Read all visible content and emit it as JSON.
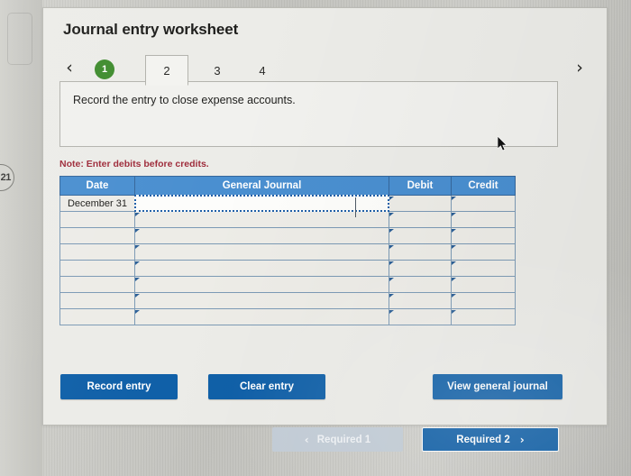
{
  "edge_badge": {
    "label": "21"
  },
  "page": {
    "title": "Journal entry worksheet"
  },
  "tabs": {
    "prev_icon": "‹",
    "next_icon": "›",
    "items": [
      {
        "label": "1",
        "state": "completed"
      },
      {
        "label": "2",
        "state": "active"
      },
      {
        "label": "3",
        "state": "inactive"
      },
      {
        "label": "4",
        "state": "inactive"
      }
    ]
  },
  "instruction": {
    "text": "Record the entry to close expense accounts."
  },
  "note": {
    "text": "Note: Enter debits before credits."
  },
  "table": {
    "headers": {
      "date": "Date",
      "general_journal": "General Journal",
      "debit": "Debit",
      "credit": "Credit"
    },
    "rows": [
      {
        "date": "December 31",
        "general_journal": "",
        "debit": "",
        "credit": "",
        "selected": true
      },
      {
        "date": "",
        "general_journal": "",
        "debit": "",
        "credit": ""
      },
      {
        "date": "",
        "general_journal": "",
        "debit": "",
        "credit": ""
      },
      {
        "date": "",
        "general_journal": "",
        "debit": "",
        "credit": ""
      },
      {
        "date": "",
        "general_journal": "",
        "debit": "",
        "credit": ""
      },
      {
        "date": "",
        "general_journal": "",
        "debit": "",
        "credit": ""
      },
      {
        "date": "",
        "general_journal": "",
        "debit": "",
        "credit": ""
      },
      {
        "date": "",
        "general_journal": "",
        "debit": "",
        "credit": ""
      }
    ]
  },
  "actions": {
    "record_entry": "Record entry",
    "clear_entry": "Clear entry",
    "view_general_journal": "View general journal"
  },
  "requirement_nav": {
    "prev_label": "Required 1",
    "prev_icon": "‹",
    "next_label": "Required 2",
    "next_icon": "›"
  },
  "colors": {
    "table_header_blue": "#4a8fd0",
    "button_blue": "#1060a8",
    "completed_tab_green": "#3f8c2e",
    "note_red": "#9e2b3a",
    "disabled_gray": "#c3cdd7",
    "selection_border": "#1f5fa8"
  }
}
